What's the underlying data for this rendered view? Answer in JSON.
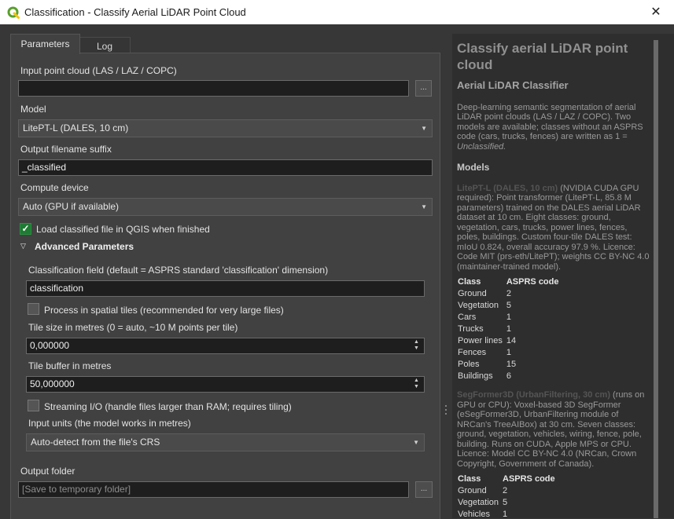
{
  "window": {
    "title": "Classification - Classify Aerial LiDAR Point Cloud",
    "close_glyph": "✕"
  },
  "tabs": {
    "parameters": "Parameters",
    "log": "Log"
  },
  "form": {
    "input_label": "Input point cloud (LAS / LAZ / COPC)",
    "input_value": "",
    "browse_label": "...",
    "model_label": "Model",
    "model_value": "LitePT-L (DALES, 10 cm)",
    "suffix_label": "Output filename suffix",
    "suffix_value": "_classified",
    "device_label": "Compute device",
    "device_value": "Auto (GPU if available)",
    "load_label": "Load classified file in QGIS when finished",
    "load_checked": true,
    "advanced_label": "Advanced Parameters",
    "advanced_toggle": "▽",
    "field_label": "Classification field (default = ASPRS standard 'classification' dimension)",
    "field_value": "classification",
    "tiles_label": "Process in spatial tiles (recommended for very large files)",
    "tiles_checked": false,
    "tile_size_label": "Tile size in metres (0 = auto, ~10 M points per tile)",
    "tile_size_value": "0,000000",
    "tile_buffer_label": "Tile buffer in metres",
    "tile_buffer_value": "50,000000",
    "streaming_label": "Streaming I/O (handle files larger than RAM; requires tiling)",
    "streaming_checked": false,
    "units_label": "Input units (the model works in metres)",
    "units_value": "Auto-detect from the file's CRS",
    "output_label": "Output folder",
    "output_placeholder": "[Save to temporary folder]",
    "output_button": "..."
  },
  "help": {
    "title": "Classify aerial LiDAR point cloud",
    "subtitle": "Aerial LiDAR Classifier",
    "intro": "Deep-learning semantic segmentation of aerial LiDAR point clouds (LAS / LAZ / COPC). Two models are available; classes without an ASPRS code (cars, trucks, fences) are written as 1 = ",
    "intro_italic": "Unclassified.",
    "models_heading": "Models",
    "model1_name": "LitePT-L (DALES, 10 cm)",
    "model1_desc": " (NVIDIA CUDA GPU required): Point transformer (LitePT-L, 85.8 M parameters) trained on the DALES aerial LiDAR dataset at 10 cm. Eight classes: ground, vegetation, cars, trucks, power lines, fences, poles, buildings. Custom four-tile DALES test: mIoU 0.824, overall accuracy 97.9 %. Licence: Code MIT (prs-eth/LitePT); weights CC BY-NC 4.0 (maintainer-trained model).",
    "table_header": [
      "Class",
      "ASPRS code"
    ],
    "table1": [
      [
        "Ground",
        "2"
      ],
      [
        "Vegetation",
        "5"
      ],
      [
        "Cars",
        "1"
      ],
      [
        "Trucks",
        "1"
      ],
      [
        "Power lines",
        "14"
      ],
      [
        "Fences",
        "1"
      ],
      [
        "Poles",
        "15"
      ],
      [
        "Buildings",
        "6"
      ]
    ],
    "model2_name": "SegFormer3D (UrbanFiltering, 30 cm)",
    "model2_desc": " (runs on GPU or CPU): Voxel-based 3D SegFormer (eSegFormer3D, UrbanFiltering module of NRCan's TreeAIBox) at 30 cm. Seven classes: ground, vegetation, vehicles, wiring, fence, pole, building. Runs on CUDA, Apple MPS or CPU. Licence: Model CC BY-NC 4.0 (NRCan, Crown Copyright, Government of Canada).",
    "table2": [
      [
        "Ground",
        "2"
      ],
      [
        "Vegetation",
        "5"
      ],
      [
        "Vehicles",
        "1"
      ]
    ]
  },
  "colors": {
    "accent_check": "#1f7a33",
    "qgis_logo": "#5aa02c"
  }
}
